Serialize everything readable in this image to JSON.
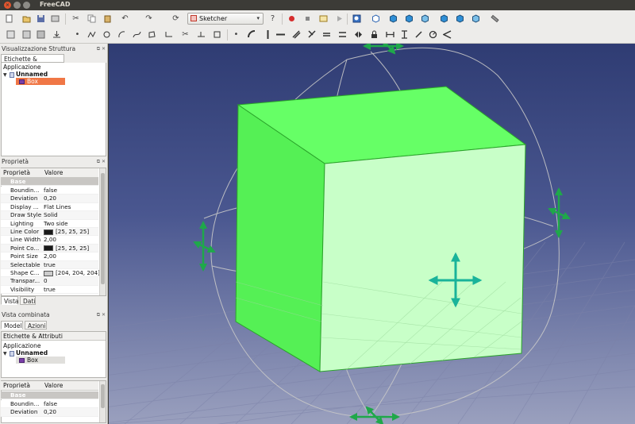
{
  "window": {
    "title": "FreeCAD"
  },
  "toolbar": {
    "workbench_selected": "Sketcher"
  },
  "tree_panel": {
    "title": "Visualizzazione Struttura",
    "tab_label": "Etichette & Attributi",
    "root_label": "Applicazione",
    "document_label": "Unnamed",
    "object_label": "Box"
  },
  "property_panel": {
    "title": "Proprietà",
    "col_property": "Proprietà",
    "col_value": "Valore",
    "group": "Base",
    "rows": [
      {
        "name": "Boundin...",
        "value": "false"
      },
      {
        "name": "Deviation",
        "value": "0,20"
      },
      {
        "name": "Display ...",
        "value": "Flat Lines"
      },
      {
        "name": "Draw Style",
        "value": "Solid"
      },
      {
        "name": "Lighting",
        "value": "Two side"
      },
      {
        "name": "Line Color",
        "value": "[25, 25, 25]",
        "color": "#191919"
      },
      {
        "name": "Line Width",
        "value": "2,00"
      },
      {
        "name": "Point Co...",
        "value": "[25, 25, 25]",
        "color": "#191919"
      },
      {
        "name": "Point Size",
        "value": "2,00"
      },
      {
        "name": "Selectable",
        "value": "true"
      },
      {
        "name": "Shape C...",
        "value": "[204, 204, 204]",
        "color": "#cccccc"
      },
      {
        "name": "Transpar...",
        "value": "0"
      },
      {
        "name": "Visibility",
        "value": "true"
      }
    ],
    "tabs": [
      "Vista",
      "Dati"
    ]
  },
  "combo_panel": {
    "title": "Vista combinata",
    "tabs": [
      "Model",
      "Azioni"
    ],
    "tab_label": "Etichette & Attributi",
    "root_label": "Applicazione",
    "document_label": "Unnamed",
    "object_label": "Box",
    "col_property": "Proprietà",
    "col_value": "Valore",
    "group": "Base",
    "rows": [
      {
        "name": "Boundin...",
        "value": "false"
      },
      {
        "name": "Deviation",
        "value": "0,20"
      }
    ]
  },
  "colors": {
    "box_face": "#66ff66",
    "box_face_light": "#c8ffc8",
    "dragger_green": "#1fa84a",
    "dragger_teal": "#19b39a",
    "selection_orange": "#f07746"
  }
}
